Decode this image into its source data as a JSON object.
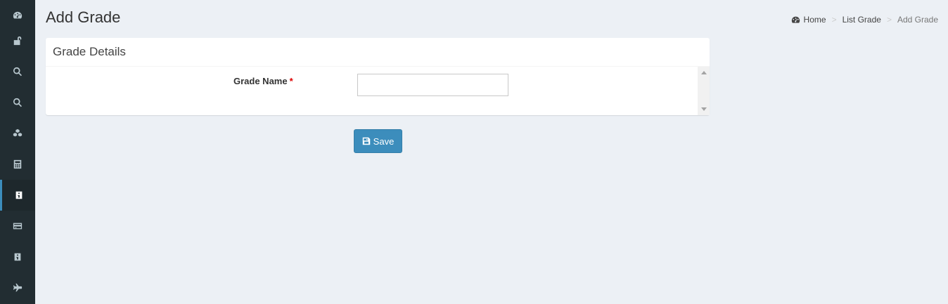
{
  "sidebar": {
    "items": [
      {
        "icon": "dashboard-icon"
      },
      {
        "icon": "unlock-icon"
      },
      {
        "icon": "search-icon"
      },
      {
        "icon": "search-icon"
      },
      {
        "icon": "cubes-icon"
      },
      {
        "icon": "calculator-icon"
      },
      {
        "icon": "id-badge-icon",
        "active": true
      },
      {
        "icon": "credit-card-icon"
      },
      {
        "icon": "id-badge-icon"
      },
      {
        "icon": "plane-icon"
      }
    ]
  },
  "header": {
    "title": "Add Grade",
    "breadcrumb": {
      "home": "Home",
      "list": "List Grade",
      "current": "Add Grade",
      "separator": ">"
    }
  },
  "form": {
    "box_title": "Grade Details",
    "grade_name_label": "Grade Name",
    "required_mark": "*",
    "grade_name_value": "",
    "save_label": "Save"
  },
  "colors": {
    "sidebar_bg": "#222d32",
    "accent": "#3c8dbc",
    "page_bg": "#ecf0f5",
    "required": "#dd0000"
  }
}
